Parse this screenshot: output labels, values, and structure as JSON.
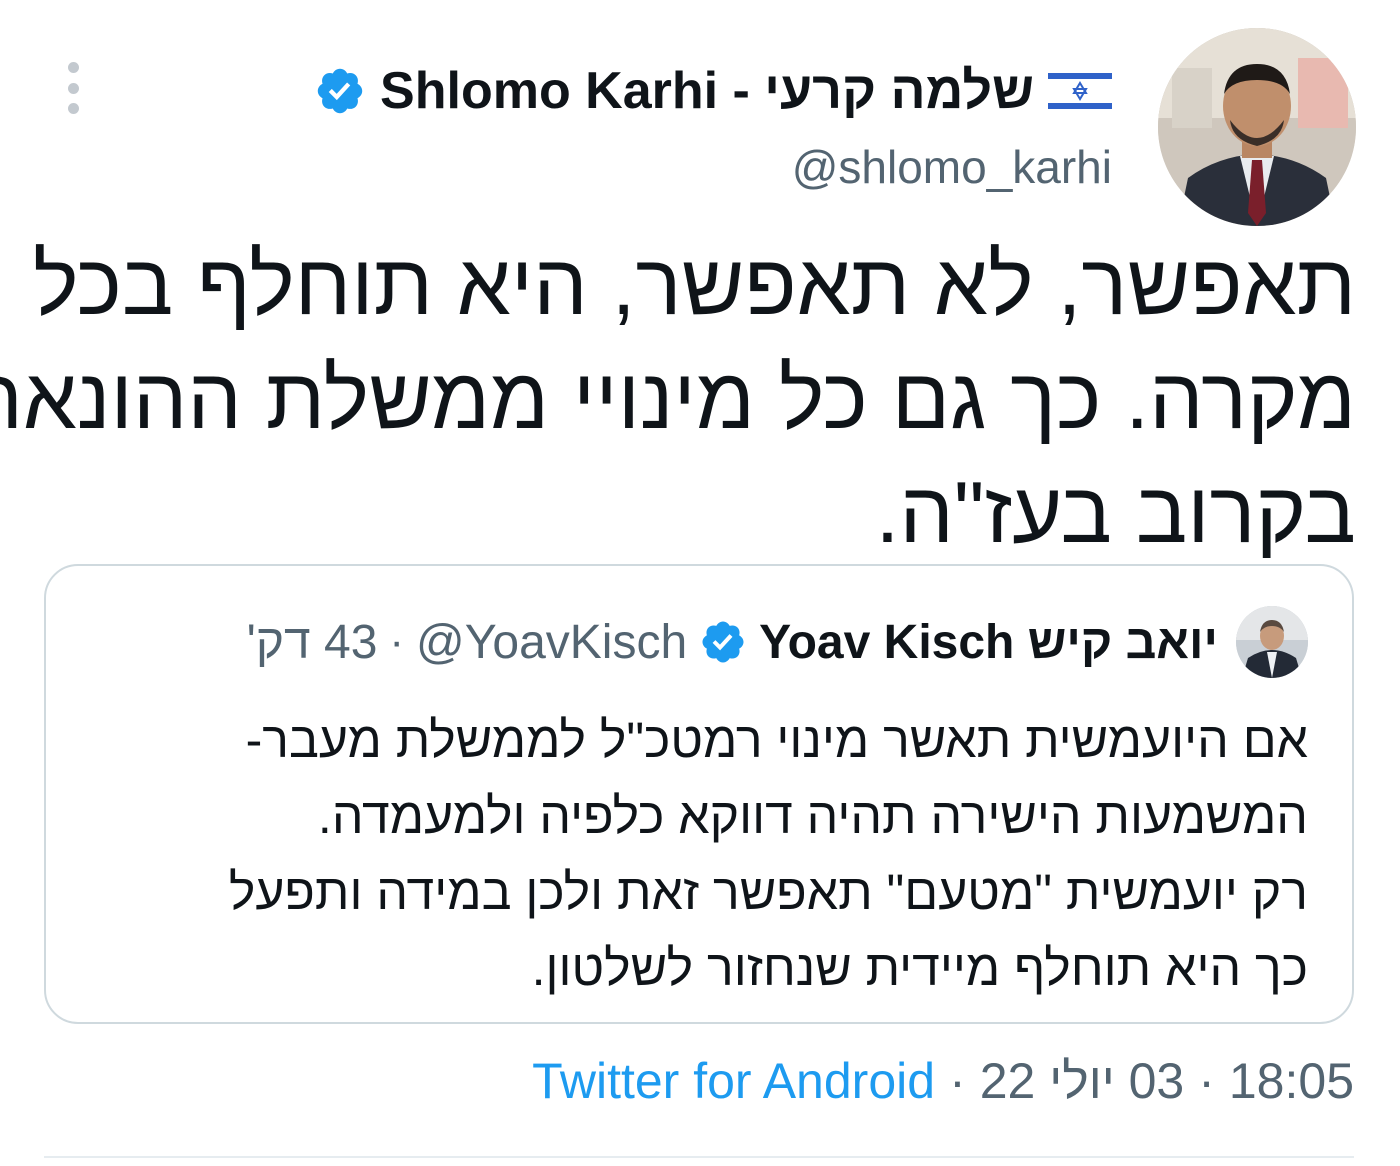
{
  "author": {
    "display_name": "שלמה קרעי - Shlomo Karhi",
    "handle": "@shlomo_karhi",
    "flag_icon": "israel-flag-icon",
    "verified_icon": "verified-badge-icon"
  },
  "tweet": {
    "text_lines": [
      "תאפשר, לא תאפשר, היא תוחלף בכל",
      "מקרה. כך גם כל מינויי ממשלת ההונאה.",
      "בקרוב בעז\"ה."
    ]
  },
  "quoted_tweet": {
    "display_name": "יואב קיש Yoav Kisch",
    "handle": "@YoavKisch",
    "separator": "·",
    "time": "43 דק'",
    "text_lines": [
      "אם היועמשית תאשר מינוי רמטכ\"ל לממשלת מעבר-",
      "המשמעות הישירה תהיה דווקא כלפיה ולמעמדה.",
      "רק יועמשית \"מטעם\" תאפשר זאת ולכן במידה ותפעל",
      "כך היא תוחלף מיידית שנחזור לשלטון."
    ]
  },
  "meta": {
    "time": "18:05",
    "separator": "·",
    "date": "03 יולי 22",
    "source": "Twitter for Android"
  },
  "colors": {
    "text": "#0f1419",
    "secondary": "#536471",
    "link": "#1d9bf0",
    "border": "#cfd9de"
  }
}
